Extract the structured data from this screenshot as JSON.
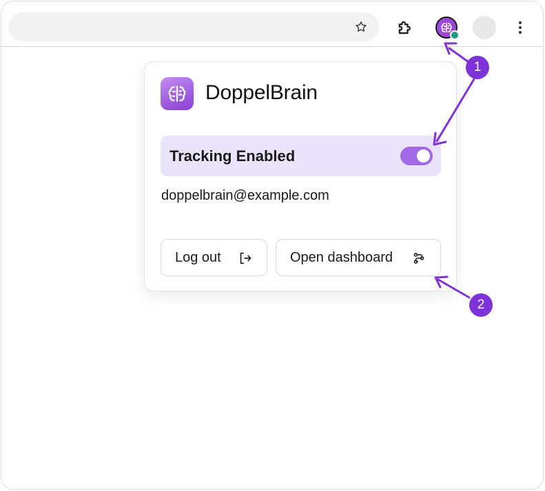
{
  "toolbar": {
    "omnibox_icon": "star-icon",
    "extension_icon": "puzzle-icon",
    "app_icon": "brain-icon",
    "menu_icon": "kebab-menu-icon"
  },
  "popup": {
    "brand_name": "DoppelBrain",
    "tracking_label": "Tracking Enabled",
    "tracking_enabled": true,
    "email": "doppelbrain@example.com",
    "logout_label": "Log out",
    "dashboard_label": "Open dashboard"
  },
  "annotations": {
    "badge_1": "1",
    "badge_2": "2",
    "accent_color": "#7d33d8"
  },
  "colors": {
    "brand_purple": "#9a4ad6",
    "tracking_bg": "#eae3fb",
    "toggle_on": "#a26ae6",
    "status_dot": "#1d9b8c"
  }
}
